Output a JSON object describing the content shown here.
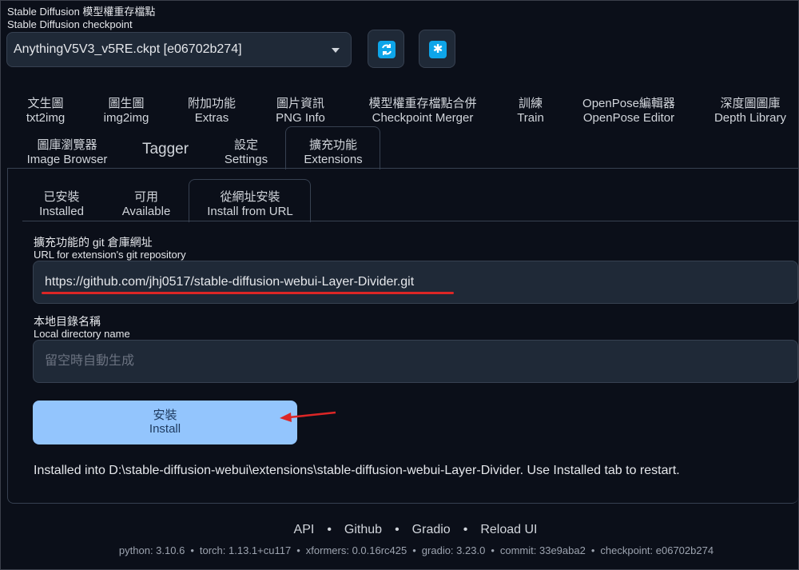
{
  "checkpoint": {
    "label_zh": "Stable Diffusion 模型權重存檔點",
    "label_en": "Stable Diffusion checkpoint",
    "selected": "AnythingV5V3_v5RE.ckpt [e06702b274]",
    "refresh_icon": "refresh-icon",
    "extra_icon": "asterisk-icon",
    "icon_color": "#0ea5e9"
  },
  "tabs": [
    {
      "zh": "文生圖",
      "en": "txt2img"
    },
    {
      "zh": "圖生圖",
      "en": "img2img"
    },
    {
      "zh": "附加功能",
      "en": "Extras"
    },
    {
      "zh": "圖片資訊",
      "en": "PNG Info"
    },
    {
      "zh": "模型權重存檔點合併",
      "en": "Checkpoint Merger"
    },
    {
      "zh": "訓練",
      "en": "Train"
    },
    {
      "zh": "OpenPose編輯器",
      "en": "OpenPose Editor"
    },
    {
      "zh": "深度圖圖庫",
      "en": "Depth Library"
    },
    {
      "zh": "圖庫瀏覽器",
      "en": "Image Browser"
    },
    {
      "zh": "Tagger",
      "en": ""
    },
    {
      "zh": "設定",
      "en": "Settings"
    },
    {
      "zh": "擴充功能",
      "en": "Extensions"
    }
  ],
  "subtabs": [
    {
      "zh": "已安裝",
      "en": "Installed"
    },
    {
      "zh": "可用",
      "en": "Available"
    },
    {
      "zh": "從網址安裝",
      "en": "Install from URL"
    }
  ],
  "url_field": {
    "label_zh": "擴充功能的 git 倉庫網址",
    "label_en": "URL for extension's git repository",
    "value": "https://github.com/jhj0517/stable-diffusion-webui-Layer-Divider.git"
  },
  "dir_field": {
    "label_zh": "本地目錄名稱",
    "label_en": "Local directory name",
    "placeholder": "留空時自動生成"
  },
  "install_button": {
    "zh": "安裝",
    "en": "Install",
    "color": "#93c5fd"
  },
  "result_text": "Installed into D:\\stable-diffusion-webui\\extensions\\stable-diffusion-webui-Layer-Divider. Use Installed tab to restart.",
  "footer": {
    "links": [
      "API",
      "Github",
      "Gradio",
      "Reload UI"
    ],
    "separator": "•",
    "info": [
      "python: 3.10.6",
      "torch: 1.13.1+cu117",
      "xformers: 0.0.16rc425",
      "gradio: 3.23.0",
      "commit: 33e9aba2",
      "checkpoint: e06702b274"
    ]
  },
  "annotation_color": "#dc2626"
}
